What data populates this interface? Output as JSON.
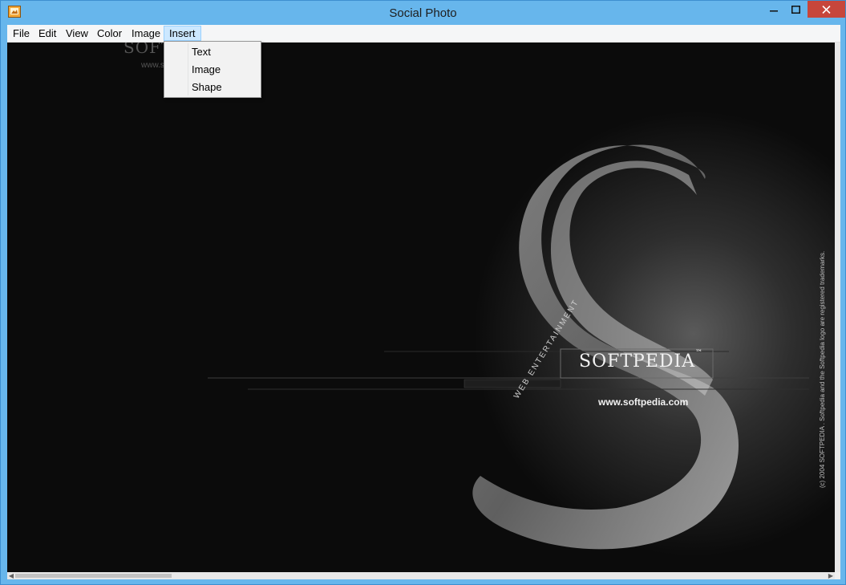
{
  "window": {
    "title": "Social Photo",
    "controls": {
      "minimize": "–",
      "maximize": "□",
      "close": "✕"
    }
  },
  "menubar": {
    "items": [
      "File",
      "Edit",
      "View",
      "Color",
      "Image",
      "Insert"
    ],
    "active": "Insert"
  },
  "insert_menu": {
    "items": [
      "Text",
      "Image",
      "Shape"
    ]
  },
  "canvas_image": {
    "watermark_top": "SOFTPEDIA",
    "watermark_url_top": "www.softpedia.com",
    "brand": "SOFTPEDIA",
    "trademark": "™",
    "url": "www.softpedia.com",
    "curved_text": "WEB ENTERTAINMENT",
    "copyright_vertical": "(c) 2004  SOFTPEDIA .  Softpedia and the Softpedia logo are registered trademarks."
  },
  "colors": {
    "titlebar": "#67b6ec",
    "close_button": "#c7463b",
    "canvas_bg": "#0b0b0b",
    "menu_active": "#cce8ff"
  }
}
